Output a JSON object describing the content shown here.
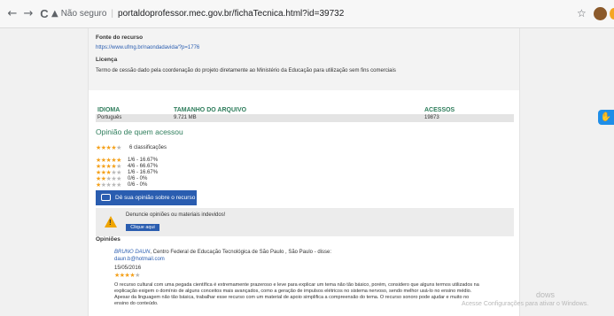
{
  "browser": {
    "back": "←",
    "forward": "→",
    "reload": "C",
    "warning_icon": "▲",
    "not_secure": "Não seguro",
    "url": "portaldoprofessor.mec.gov.br/fichaTecnica.html?id=39732",
    "bookmark_icon": "☆"
  },
  "resource": {
    "source_label": "Fonte do recurso",
    "source_url": "https://www.ufmg.br/naondadavida/?p=1776",
    "license_label": "Licença",
    "license_text": "Termo de cessão dado pela coordenação do projeto diretamente ao Ministério da Educação para utilização sem fins comerciais"
  },
  "file_table": {
    "headers": [
      "IDIOMA",
      "TAMANHO DO ARQUIVO",
      "ACESSOS"
    ],
    "row": [
      "Português",
      "9.721 MB",
      "19873"
    ]
  },
  "ratings": {
    "title": "Opinião de quem acessou",
    "total": "6 classificações",
    "summary_stars": 4,
    "rows": [
      {
        "stars": 5,
        "text": "1/6 - 16.67%"
      },
      {
        "stars": 4,
        "text": "4/6 - 66.67%"
      },
      {
        "stars": 3,
        "text": "1/6 - 16.67%"
      },
      {
        "stars": 2,
        "text": "0/6 - 0%"
      },
      {
        "stars": 1,
        "text": "0/6 - 0%"
      }
    ],
    "opinion_button": "Dê sua opinião sobre o recurso"
  },
  "report": {
    "text": "Denuncie opiniões ou materiais indevidos!",
    "button": "Clique aqui"
  },
  "opinions": {
    "title": "Opiniões",
    "author": "BRUNO DAUN",
    "author_rest": ", Centro Federal de Educação Tecnológica de São Paulo , São Paulo - disse:",
    "email": "daun.b@hotmail.com",
    "date": "15/05/2016",
    "stars": 4,
    "line1": "O recurso cultural com uma pegada científica é extremamente prazeroso e leve para explicar um tema não tão básico, porém, considero que alguns termos utilizados na",
    "line2": "explicação exigem o domínio de alguns conceitos mais avançados, como a geração de impulsos elétricos no sistema nervoso, sendo melhor usá-lo no ensino médio.",
    "line3": "Apesar da linguagem não tão básica, trabalhar esse recurso com um material de apoio simplifica a compreensão do tema. O recurso sonoro pode ajudar e muito no",
    "line4": "ensino do conteúdo."
  },
  "windows": {
    "line1": "dows",
    "line2": "Acesse Configurações para ativar o Windows."
  },
  "colors": {
    "accent": "#2a5db0",
    "green": "#2e7d5b",
    "star": "#f4a11c"
  }
}
